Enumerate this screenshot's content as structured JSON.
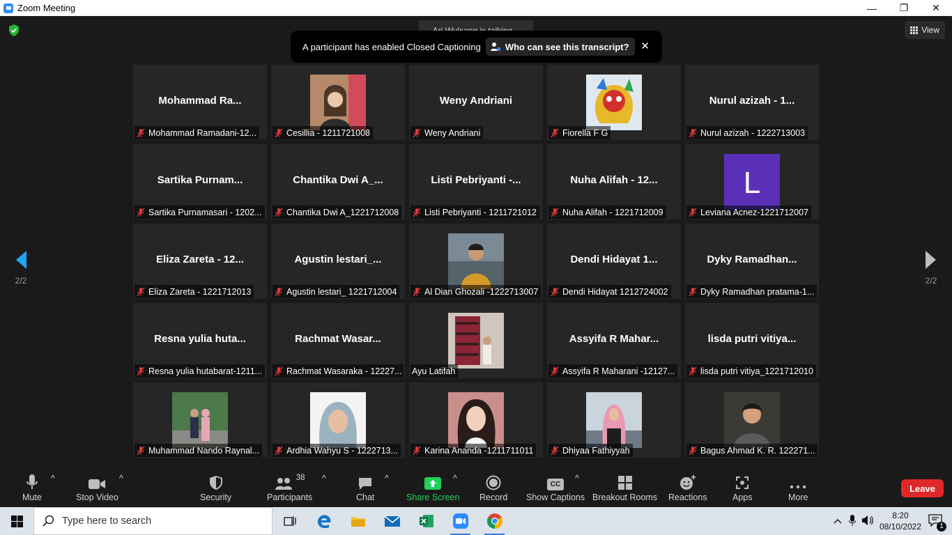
{
  "window": {
    "title": "Zoom Meeting",
    "controls": [
      "—",
      "❐",
      "✕"
    ]
  },
  "meeting": {
    "talking_indicator": "Ari Wulsang is talking...",
    "view_label": "View",
    "banner": {
      "message": "A participant has enabled Closed Captioning",
      "who_label": "Who can see this transcript?",
      "close": "✕"
    },
    "page_left": "2/2",
    "page_right": "2/2",
    "tiles": [
      {
        "big": "Mohammad  Ra...",
        "label": "Mohammad Ramadani-12...",
        "photo": null
      },
      {
        "big": "",
        "label": "Cesillia - 1211721008",
        "photo": "person"
      },
      {
        "big": "Weny Andriani",
        "label": "Weny Andriani",
        "photo": null
      },
      {
        "big": "",
        "label": "Fiorella F G",
        "photo": "lion"
      },
      {
        "big": "Nurul azizah - 1...",
        "label": "Nurul azizah - 1222713003",
        "photo": null
      },
      {
        "big": "Sartika  Purnam...",
        "label": "Sartika Purnamasari - 1202...",
        "photo": null
      },
      {
        "big": "Chantika  Dwi  A_...",
        "label": "Chantika Dwi A_1221712008",
        "photo": null
      },
      {
        "big": "Listi  Pebriyanti  -...",
        "label": "Listi Pebriyanti - 1211721012",
        "photo": null
      },
      {
        "big": "Nuha  Alifah  -  12...",
        "label": "Nuha Alifah - 1221712009",
        "photo": null
      },
      {
        "big": "",
        "label": "Leviana Acnez-1221712007",
        "photo": "L"
      },
      {
        "big": "Eliza  Zareta  -  12...",
        "label": "Eliza Zareta - 1221712013",
        "photo": null
      },
      {
        "big": "Agustin  lestari_...",
        "label": "Agustin lestari_ 1221712004",
        "photo": null
      },
      {
        "big": "",
        "label": "Al Dian Ghozali -1222713007",
        "photo": "man"
      },
      {
        "big": "Dendi  Hidayat  1...",
        "label": "Dendi Hidayat 1212724002",
        "photo": null
      },
      {
        "big": "Dyky  Ramadhan...",
        "label": "Dyky Ramadhan pratama-1...",
        "photo": null
      },
      {
        "big": "Resna  yulia  huta...",
        "label": "Resna yulia hutabarat-1211...",
        "photo": null
      },
      {
        "big": "Rachmat  Wasar...",
        "label": "Rachmat Wasaraka - 12227...",
        "photo": null
      },
      {
        "big": "",
        "label": "Ayu Latifah",
        "photo": "weave",
        "nomute": true
      },
      {
        "big": "Assyifa  R  Mahar...",
        "label": "Assyifa R Maharani -12127...",
        "photo": null
      },
      {
        "big": "lisda  putri  vitiya...",
        "label": "lisda putri vitiya_1221712010",
        "photo": null
      },
      {
        "big": "",
        "label": "Muhammad Nando Raynal...",
        "photo": "couple"
      },
      {
        "big": "",
        "label": "Ardhia Wahyu S - 1222713...",
        "photo": "hijab"
      },
      {
        "big": "",
        "label": "Karina Ananda -1211711011",
        "photo": "woman"
      },
      {
        "big": "",
        "label": "Dhiyaa Fathiyyah",
        "photo": "hijab2"
      },
      {
        "big": "",
        "label": "Bagus Ahmad K. R. 122271...",
        "photo": "man2"
      }
    ]
  },
  "toolbar": {
    "mute": "Mute",
    "stop_video": "Stop Video",
    "security": "Security",
    "participants": "Participants",
    "participants_count": "38",
    "chat": "Chat",
    "share_screen": "Share Screen",
    "record": "Record",
    "show_captions": "Show Captions",
    "captions_icon": "CC",
    "breakout": "Breakout Rooms",
    "reactions": "Reactions",
    "apps": "Apps",
    "more": "More",
    "leave": "Leave",
    "caret": "^"
  },
  "taskbar": {
    "search_placeholder": "Type here to search",
    "time": "8:20",
    "date": "08/10/2022",
    "notifications": "1"
  },
  "colors": {
    "accent_blue": "#2d8cff",
    "share_green": "#20d15a",
    "leave_red": "#e02828",
    "mute_red": "#e03a3a",
    "avatar_purple": "#5b30b8"
  }
}
